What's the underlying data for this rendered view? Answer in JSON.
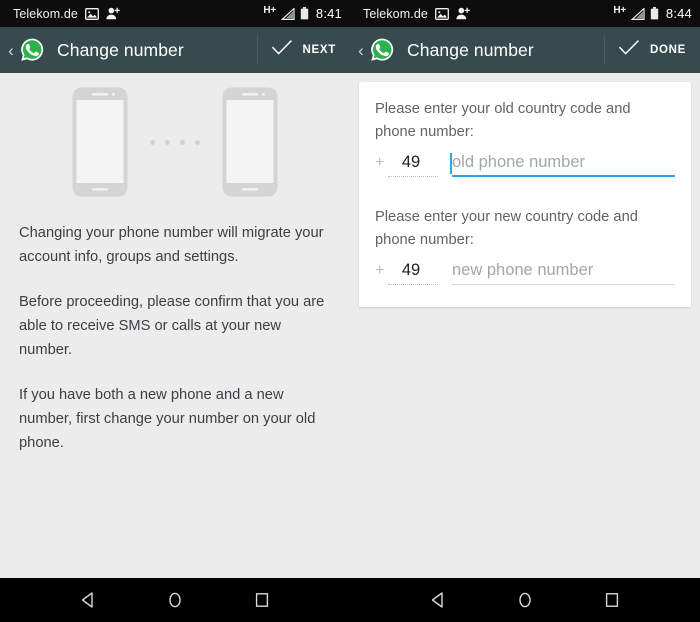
{
  "theme": {
    "actionbar_bg": "#374b4e",
    "statusbar_bg": "#0d0d0d",
    "page_bg": "#ececec",
    "card_bg": "#ffffff",
    "accent_focus": "#29a7e1",
    "whatsapp_green": "#25d366",
    "navbar_bg": "#000000"
  },
  "panels": [
    {
      "status_bar": {
        "carrier": "Telekom.de",
        "icons": [
          "screenshot-icon",
          "add-contact-icon"
        ],
        "network": "H+",
        "signal": "signal-bars-icon",
        "battery": "battery-icon",
        "time": "8:41"
      },
      "action_bar": {
        "back": "‹",
        "logo": "whatsapp-logo-icon",
        "title": "Change number",
        "action_icon": "checkmark-icon",
        "action_label": "NEXT"
      },
      "illustration": {
        "name": "two-phones-transfer-illustration",
        "dots": 4
      },
      "paragraphs": [
        "Changing your phone number will migrate your account info, groups and settings.",
        "Before proceeding, please confirm that you are able to receive SMS or calls at your new number.",
        "If you have both a new phone and a new number, first change your number on your old phone."
      ]
    },
    {
      "status_bar": {
        "carrier": "Telekom.de",
        "icons": [
          "screenshot-icon",
          "add-contact-icon"
        ],
        "network": "H+",
        "signal": "signal-bars-icon",
        "battery": "battery-icon",
        "time": "8:44"
      },
      "action_bar": {
        "back": "‹",
        "logo": "whatsapp-logo-icon",
        "title": "Change number",
        "action_icon": "checkmark-icon",
        "action_label": "DONE"
      },
      "form": {
        "old": {
          "label": "Please enter your old country code and phone number:",
          "plus": "+",
          "country_code": "49",
          "number_value": "",
          "number_placeholder": "old phone number",
          "focused": true
        },
        "new": {
          "label": "Please enter your new country code and phone number:",
          "plus": "+",
          "country_code": "49",
          "number_value": "",
          "number_placeholder": "new phone number",
          "focused": false
        }
      }
    }
  ],
  "nav_bar": {
    "buttons": [
      "back-nav-icon",
      "home-nav-icon",
      "recents-nav-icon"
    ]
  }
}
